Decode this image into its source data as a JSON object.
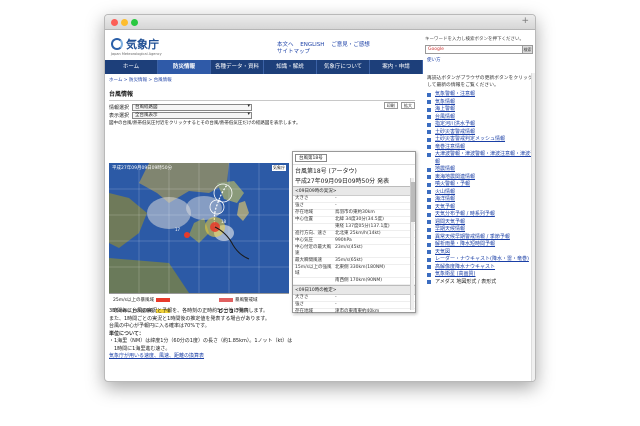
{
  "browser": {
    "newtab": "+"
  },
  "header": {
    "site_title": "気象庁",
    "site_subtitle": "Japan Meteorological Agency",
    "links": [
      "本文へ",
      "ENGLISH",
      "ご意見・ご感想",
      "サイトマップ"
    ],
    "search_hint": "キーワードを入力し検索ボタンを押下ください。",
    "search_brand": "Google",
    "search_button": "検索",
    "small_link": "使い方"
  },
  "nav": {
    "items": [
      "ホーム",
      "防災情報",
      "各種データ・資料",
      "知識・解説",
      "気象庁について",
      "案内・申請"
    ]
  },
  "main": {
    "breadcrumb": "ホーム > 防災情報 > 台風情報",
    "title": "台風情報",
    "info_select_label": "情報選択",
    "info_select_value": "台風経路図",
    "display_select_label": "表示選択",
    "display_select_value": "全台風表示",
    "size_buttons": [
      "印刷",
      "拡大"
    ],
    "intro": "図中の台風/熱帯低気圧付近をクリックするとその台風/熱帯低気圧だけの経路図を表示します。"
  },
  "map": {
    "title": "平成27年09月09日09時50分",
    "stamp": "気象庁",
    "legend": [
      {
        "label": "25m/s以上の暴風域",
        "color": "#e83a2a"
      },
      {
        "label": "15m/s以上の強風域",
        "color": "#f2d33a"
      },
      {
        "label": "暴風警戒域",
        "color": "#e06060"
      },
      {
        "label": "予報円",
        "color": "#ffffff"
      }
    ]
  },
  "info": {
    "select": "台風第18号",
    "name": "台風第18号 (アータウ)",
    "time": "平成27年09月09日09時50分 発表",
    "sections": [
      {
        "heading": "<09日09時の実況>",
        "rows": [
          [
            "大きさ",
            "-"
          ],
          [
            "強さ",
            "-"
          ],
          [
            "存在地域",
            "鳥羽市の東約30km"
          ],
          [
            "中心位置",
            "北緯 34度30分(34.5度)"
          ],
          [
            "",
            "東経 137度05分(137.1度)"
          ],
          [
            "進行方向、速さ",
            "北北東 25km/h(14kt)"
          ],
          [
            "中心気圧",
            "990hPa"
          ],
          [
            "中心付近の最大風速",
            "23m/s(45kt)"
          ],
          [
            "最大瞬間風速",
            "35m/s(65kt)"
          ],
          [
            "15m/s以上の強風域",
            "北東側 330km(180NM)"
          ],
          [
            "",
            "南西側 170km(90NM)"
          ]
        ]
      },
      {
        "heading": "<09日10時の推定>",
        "rows": [
          [
            "大きさ",
            "-"
          ],
          [
            "強さ",
            "-"
          ],
          [
            "存在地域",
            "津市の東南東約40km"
          ]
        ]
      }
    ]
  },
  "notes": {
    "lines": [
      "3時間毎に台風の実況と予報を、各時刻の正時約50分後に発表します。",
      "また、1時間ごとの実況と1時間後の推定値を発表する場合があります。",
      "台風の中心が予報円に入る確率は70%です。"
    ],
    "units_heading": "単位について：",
    "units_lines": [
      "・1海里（NM）は緯度1分（60分の1度）の長さ（約1.85km）。1ノット（kt）は",
      "　1時間に1海里進む速さ。"
    ],
    "link": "気象庁が用いる速度、風速、距離の換算表"
  },
  "sidebar": {
    "intro": "再読込ボタンがブラウザの更新ボタンをクリックして最新の情報をご覧ください。",
    "items": [
      "気象警報・注意報",
      "気象情報",
      "海上警報",
      "台風情報",
      "指定河川洪水予報",
      "土砂災害警戒情報",
      "土砂災害警戒判定メッシュ情報",
      "竜巻注意情報",
      "大津波警報・津波警報・津波注意報・津波予報",
      "地震情報",
      "東海地震関連情報",
      "噴火警報・予報",
      "火山情報",
      "海洋情報",
      "天気予報",
      "天気分布予報 / 時系列予報",
      "週間天気予報",
      "早期天候情報",
      "異常天候早期警戒情報 / 季節予報",
      "解析雨量・降水短時間予報",
      "天気図",
      "レーダー・ナウキャスト(降水・雷・竜巻)",
      "高解像度降水ナウキャスト",
      "気象衛星 (高画質)",
      "アメダス 地図形式 / 表形式"
    ]
  }
}
